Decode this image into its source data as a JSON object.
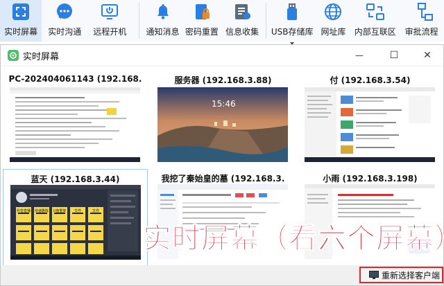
{
  "toolbar": {
    "items": [
      {
        "label": "实时屏幕",
        "icon": "screen-capture-icon",
        "active": true
      },
      {
        "label": "实时沟通",
        "icon": "chat-bubble-icon"
      },
      {
        "label": "远程开机",
        "icon": "power-on-icon"
      },
      {
        "label": "通知消息",
        "icon": "bell-icon"
      },
      {
        "label": "密码重置",
        "icon": "password-lock-icon"
      },
      {
        "label": "信息收集",
        "icon": "info-collect-icon"
      },
      {
        "label": "USB存储库",
        "icon": "usb-icon",
        "has_dropdown": true
      },
      {
        "label": "网址库",
        "icon": "globe-icon"
      },
      {
        "label": "内部互联区",
        "icon": "network-icon"
      },
      {
        "label": "审批流程",
        "icon": "approval-flow-icon"
      }
    ]
  },
  "window": {
    "title": "实时屏幕",
    "minimize": "—",
    "maximize": "☐",
    "close": "✕"
  },
  "screens": [
    {
      "title": "PC-202404061143 (192.168.",
      "selected": false
    },
    {
      "title": "服务器 (192.168.3.88)",
      "selected": false,
      "clock": "15:46"
    },
    {
      "title": "付 (192.168.3.54)",
      "selected": false
    },
    {
      "title": "蓝天 (192.168.3.44)",
      "selected": true,
      "tiles": [
        "抖音直播",
        "快速删除",
        "U盘重复",
        "文件",
        "文件"
      ]
    },
    {
      "title": "我挖了秦始皇的墓 (192.168.3.",
      "selected": false
    },
    {
      "title": "小雨 (192.168.3.198)",
      "selected": false
    }
  ],
  "footer": {
    "reselect_label": "重新选择客户端"
  },
  "overlay_caption": "实时屏幕（看六个屏幕）",
  "colors": {
    "accent": "#1e7fd6",
    "active_bg": "#dbe9f9",
    "overlay_red": "#d7152b",
    "highlight_red": "#e0262b"
  }
}
